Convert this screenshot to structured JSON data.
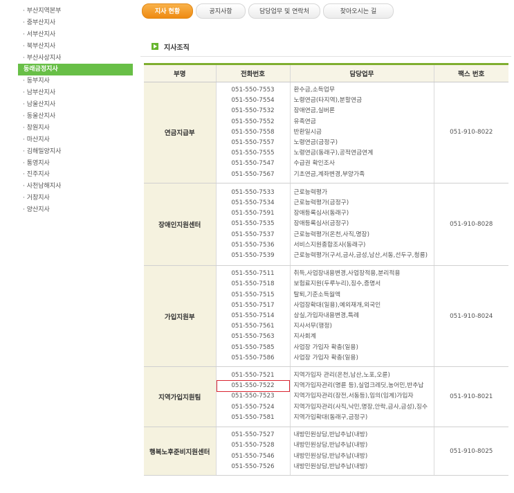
{
  "sidebar": {
    "items": [
      "· 부산지역본부",
      "· 중부산지사",
      "· 서부산지사",
      "· 북부산지사",
      "· 부산사상지사",
      "동래금정지사",
      "· 동부지사",
      "· 남부산지사",
      "· 남울산지사",
      "· 동울산지사",
      "· 창원지사",
      "· 마산지사",
      "· 김해밀양지사",
      "· 통영지사",
      "· 진주지사",
      "· 사천남해지사",
      "· 거창지사",
      "· 양산지사"
    ],
    "active_index": 5
  },
  "tabs": [
    {
      "label": "지사 현황",
      "active": true
    },
    {
      "label": "공지사항",
      "active": false
    },
    {
      "label": "담당업무 및 연락처",
      "active": false
    },
    {
      "label": "찾아오시는 길",
      "active": false
    }
  ],
  "section": {
    "title": "지사조직"
  },
  "table": {
    "headers": [
      "부명",
      "전화번호",
      "담당업무",
      "팩스 번호"
    ],
    "rows": [
      {
        "dept": "연금지급부",
        "phones": [
          "051-550-7553",
          "051-550-7554",
          "051-550-7532",
          "051-550-7552",
          "051-550-7558",
          "051-550-7557",
          "051-550-7555",
          "051-550-7547",
          "051-550-7567"
        ],
        "duties": [
          "환수금,소득업무",
          "노령연금(타지역),분할연금",
          "장애연금,실버론",
          "유족연금",
          "반환일시금",
          "노령연금(금정구)",
          "노령연금(동래구),공적연금연계",
          "수급권 확인조사",
          "기초연금,계좌변경,부양가족"
        ],
        "fax": "051-910-8022"
      },
      {
        "dept": "장애인지원센터",
        "phones": [
          "051-550-7533",
          "051-550-7534",
          "051-550-7591",
          "051-550-7535",
          "051-550-7537",
          "051-550-7536",
          "051-550-7539"
        ],
        "duties": [
          "근로능력평가",
          "근로능력평가(금정구)",
          "장애등록심사(동래구)",
          "장애등록심사(금정구)",
          "근로능력평가(온천,사직,명장)",
          "서비스지원종합조사(동래구)",
          "근로능력평가(구서,금사,금성,남산,서동,선두구,청룡)"
        ],
        "fax": "051-910-8028"
      },
      {
        "dept": "가입지원부",
        "phones": [
          "051-550-7511",
          "051-550-7518",
          "051-550-7515",
          "051-550-7517",
          "051-550-7514",
          "051-550-7561",
          "051-550-7563",
          "051-550-7585",
          "051-550-7586"
        ],
        "duties": [
          "취득,사업장내용변경,사업장적용,분리적용",
          "보험료지원(두루누리),징수,증명서",
          "탈퇴,기준소득월액",
          "사업장확대(일용),예외재개,외국인",
          "상실,가입자내용변경,특례",
          "지사서무(행정)",
          "지사회계",
          "사업장 가입자 확충(일용)",
          "사업장 가입자 확충(일용)"
        ],
        "fax": "051-910-8024"
      },
      {
        "dept": "지역가입지원팀",
        "phones": [
          "051-550-7521",
          "051-550-7522",
          "051-550-7523",
          "051-550-7524",
          "051-550-7581"
        ],
        "highlight_phone_index": 1,
        "duties": [
          "지역가입자 관리(온천,남산,노포,오륜)",
          "지역가입자관리(명륜 등),실업크레딧,농어민,반추납",
          "지역가입자관리(장전,서동등),임의(임계)가입자",
          "지역가입자관리(사직,낙민,명장,안락,금사,금성),징수",
          "지역가입확대(동래구,금정구)"
        ],
        "fax": "051-910-8021"
      },
      {
        "dept": "행복노후준비지원센터",
        "phones": [
          "051-550-7527",
          "051-550-7528",
          "051-550-7546",
          "051-550-7526"
        ],
        "duties": [
          "내방민원상담,반납추납(내방)",
          "내방민원상담,반납추납(내방)",
          "내방민원상담,반납추납(내방)",
          "내방민원상담,반납추납(내방)"
        ],
        "fax": "051-910-8025"
      }
    ]
  }
}
